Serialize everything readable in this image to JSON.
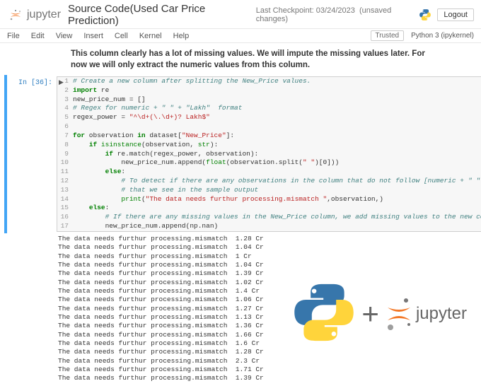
{
  "header": {
    "logo_text": "jupyter",
    "title": "Source Code(Used Car Price Prediction)",
    "checkpoint": "Last Checkpoint: 03/24/2023",
    "saved_status": "(unsaved changes)",
    "logout": "Logout"
  },
  "menubar": {
    "items": [
      "File",
      "Edit",
      "View",
      "Insert",
      "Cell",
      "Kernel",
      "Help"
    ],
    "trusted": "Trusted",
    "kernel": "Python 3 (ipykernel)"
  },
  "markdown": {
    "text": "This column clearly has a lot of missing values. We will impute the missing values later. For now we will only extract the numeric values from this column."
  },
  "code": {
    "prompt": "In [36]:",
    "lines": [
      {
        "n": "1",
        "cls": "c-italic-blue",
        "t": "# Create a new column after splitting the New_Price values."
      },
      {
        "n": "2",
        "cls": "",
        "t": "import re",
        "tokens": [
          {
            "cls": "c-kw",
            "t": "import"
          },
          {
            "cls": "",
            "t": " re"
          }
        ]
      },
      {
        "n": "3",
        "cls": "",
        "t": "new_price_num = []"
      },
      {
        "n": "4",
        "cls": "c-italic-blue",
        "t": "# Regex for numeric + \" \" + \"Lakh\"  format"
      },
      {
        "n": "5",
        "cls": "",
        "t": "regex_power = ",
        "tail_cls": "c-red",
        "tail": "\"^\\d+(\\.\\d+)? Lakh$\""
      },
      {
        "n": "6",
        "cls": "",
        "t": ""
      },
      {
        "n": "7",
        "cls": "",
        "tokens": [
          {
            "cls": "c-kw",
            "t": "for"
          },
          {
            "cls": "",
            "t": " observation "
          },
          {
            "cls": "c-kw",
            "t": "in"
          },
          {
            "cls": "",
            "t": " dataset["
          },
          {
            "cls": "c-red",
            "t": "\"New_Price\""
          },
          {
            "cls": "",
            "t": "]:"
          }
        ]
      },
      {
        "n": "8",
        "cls": "",
        "tokens": [
          {
            "cls": "",
            "t": "    "
          },
          {
            "cls": "c-kw",
            "t": "if"
          },
          {
            "cls": "",
            "t": " "
          },
          {
            "cls": "c-builtin",
            "t": "isinstance"
          },
          {
            "cls": "",
            "t": "(observation, "
          },
          {
            "cls": "c-builtin",
            "t": "str"
          },
          {
            "cls": "",
            "t": "):"
          }
        ]
      },
      {
        "n": "9",
        "cls": "",
        "tokens": [
          {
            "cls": "",
            "t": "        "
          },
          {
            "cls": "c-kw",
            "t": "if"
          },
          {
            "cls": "",
            "t": " re.match(regex_power, observation):"
          }
        ]
      },
      {
        "n": "10",
        "cls": "",
        "tokens": [
          {
            "cls": "",
            "t": "            new_price_num.append("
          },
          {
            "cls": "c-builtin",
            "t": "float"
          },
          {
            "cls": "",
            "t": "(observation.split("
          },
          {
            "cls": "c-red",
            "t": "\" \""
          },
          {
            "cls": "",
            "t": ")[0]))"
          }
        ]
      },
      {
        "n": "11",
        "cls": "",
        "tokens": [
          {
            "cls": "",
            "t": "        "
          },
          {
            "cls": "c-kw",
            "t": "else"
          },
          {
            "cls": "",
            "t": ":"
          }
        ]
      },
      {
        "n": "12",
        "cls": "c-italic-blue",
        "t": "            # To detect if there are any observations in the column that do not follow [numeric + \" \" + \"Lakh\"]  format"
      },
      {
        "n": "13",
        "cls": "c-italic-blue",
        "t": "            # that we see in the sample output"
      },
      {
        "n": "14",
        "cls": "",
        "tokens": [
          {
            "cls": "",
            "t": "            "
          },
          {
            "cls": "c-builtin",
            "t": "print"
          },
          {
            "cls": "",
            "t": "("
          },
          {
            "cls": "c-red",
            "t": "\"The data needs furthur processing.mismatch \""
          },
          {
            "cls": "",
            "t": ",observation,)"
          }
        ]
      },
      {
        "n": "15",
        "cls": "",
        "tokens": [
          {
            "cls": "",
            "t": "    "
          },
          {
            "cls": "c-kw",
            "t": "else"
          },
          {
            "cls": "",
            "t": ":"
          }
        ]
      },
      {
        "n": "16",
        "cls": "c-italic-blue",
        "t": "        # If there are any missing values in the New_Price column, we add missing values to the new column"
      },
      {
        "n": "17",
        "cls": "",
        "t": "        new_price_num.append(np.nan)"
      }
    ]
  },
  "output": {
    "lines": [
      "The data needs furthur processing.mismatch  1.28 Cr",
      "The data needs furthur processing.mismatch  1.04 Cr",
      "The data needs furthur processing.mismatch  1 Cr",
      "The data needs furthur processing.mismatch  1.04 Cr",
      "The data needs furthur processing.mismatch  1.39 Cr",
      "The data needs furthur processing.mismatch  1.02 Cr",
      "The data needs furthur processing.mismatch  1.4 Cr",
      "The data needs furthur processing.mismatch  1.06 Cr",
      "The data needs furthur processing.mismatch  1.27 Cr",
      "The data needs furthur processing.mismatch  1.13 Cr",
      "The data needs furthur processing.mismatch  1.36 Cr",
      "The data needs furthur processing.mismatch  1.66 Cr",
      "The data needs furthur processing.mismatch  1.6 Cr",
      "The data needs furthur processing.mismatch  1.28 Cr",
      "The data needs furthur processing.mismatch  2.3 Cr",
      "The data needs furthur processing.mismatch  1.71 Cr",
      "The data needs furthur processing.mismatch  1.39 Cr"
    ]
  },
  "overlay": {
    "plus": "+",
    "jupyter_name": "jupyter"
  }
}
